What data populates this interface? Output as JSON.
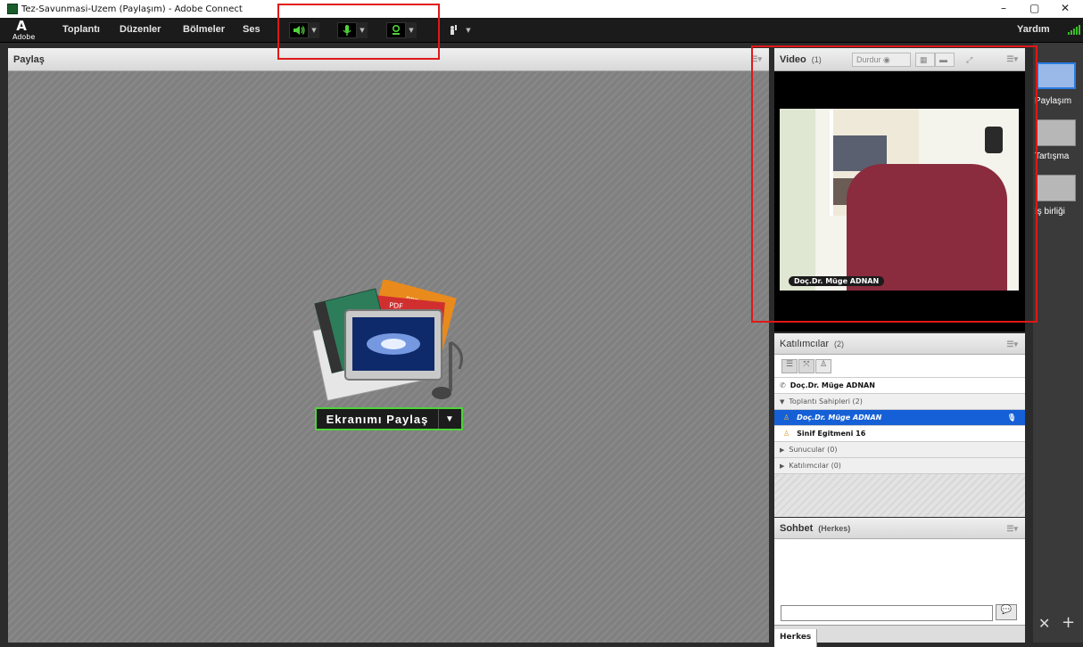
{
  "window": {
    "title": "Tez-Savunmasi-Uzem (Paylaşım) - Adobe Connect",
    "minimize": "–",
    "maximize": "▢",
    "close": "✕"
  },
  "menubar": {
    "logo_letter": "A",
    "logo_text": "Adobe",
    "items": [
      "Toplantı",
      "Düzenler",
      "Bölmeler",
      "Ses"
    ],
    "help": "Yardım",
    "icons": [
      "speaker-icon",
      "microphone-icon",
      "webcam-icon",
      "raise-hand-icon"
    ]
  },
  "share_pod": {
    "title": "Paylaş",
    "button_label": "Ekranımı Paylaş",
    "doc_labels": [
      "PPT",
      "PDF"
    ]
  },
  "video_pod": {
    "title": "Video",
    "count": "(1)",
    "stop_label": "Durdur",
    "name_tag": "Doç.Dr. Müge ADNAN"
  },
  "attendees_pod": {
    "title": "Katılımcılar",
    "count": "(2)",
    "phone_user": "Doç.Dr. Müge ADNAN",
    "hosts_header": "Toplantı Sahipleri (2)",
    "hosts": [
      "Doç.Dr. Müge ADNAN",
      "Sinif Egitmeni 16"
    ],
    "presenters_header": "Sunucular (0)",
    "participants_header": "Katılımcılar (0)"
  },
  "chat_pod": {
    "title": "Sohbet",
    "scope": "(Herkes)",
    "tab": "Herkes",
    "input_value": ""
  },
  "layouts_rail": {
    "items": [
      "Paylaşım",
      "Tartışma",
      "İş birliği"
    ]
  },
  "colors": {
    "highlight_red": "#e01818",
    "active_green": "#4fd33a",
    "selection_blue": "#1560d6"
  }
}
